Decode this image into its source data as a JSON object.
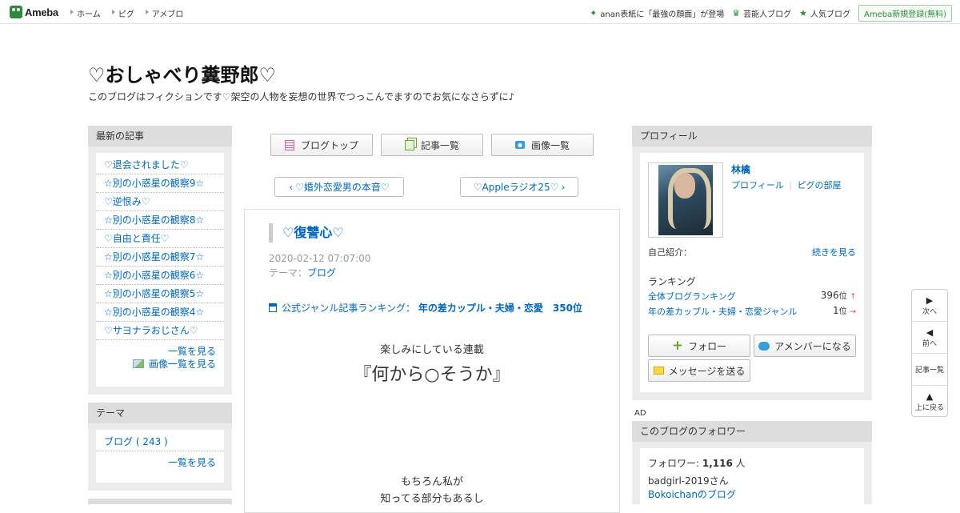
{
  "topbar": {
    "logo": "Ameba",
    "nav": [
      "ホーム",
      "ピグ",
      "アメブロ"
    ],
    "news": "anan表紙に「最強の顔面」が登場",
    "celeb": "芸能人ブログ",
    "popular": "人気ブログ",
    "register": "Ameba新規登録(無料)"
  },
  "blog": {
    "title": "♡おしゃべり糞野郎♡",
    "description": "このブログはフィクションです♡架空の人物を妄想の世界でつっこんでますのでお気になさらずに♪"
  },
  "recent": {
    "header": "最新の記事",
    "items": [
      "♡退会されました♡",
      "☆別の小惑星の観察9☆",
      "♡逆恨み♡",
      "☆別の小惑星の観察8☆",
      "♡自由と責任♡",
      "☆別の小惑星の観察7☆",
      "☆別の小惑星の観察6☆",
      "☆別の小惑星の観察5☆",
      "☆別の小惑星の観察4☆",
      "♡サヨナラおじさん♡"
    ],
    "more": "一覧を見る",
    "images": "画像一覧を見る"
  },
  "theme": {
    "header": "テーマ",
    "item": "ブログ ( 243 )",
    "more": "一覧を見る"
  },
  "tabs": {
    "top": "ブログトップ",
    "list": "記事一覧",
    "images": "画像一覧"
  },
  "pager": {
    "prev": "♡婚外恋愛男の本音♡",
    "next": "♡Appleラジオ25♡"
  },
  "article": {
    "title": "♡復讐心♡",
    "date": "2020-02-12 07:07:00",
    "theme_label": "テーマ：",
    "theme": "ブログ",
    "rank_label": "公式ジャンル記事ランキング：",
    "rank_value": "年の差カップル・夫婦・恋愛　350位",
    "line1": "楽しみにしている連載",
    "line2": "『何から○そうか』",
    "line3": "もちろん私が",
    "line4": "知ってる部分もあるし"
  },
  "profile": {
    "header": "プロフィール",
    "name": "林檎",
    "link_profile": "プロフィール",
    "link_room": "ピグの部屋",
    "intro_label": "自己紹介：",
    "intro_more": "続きを見る",
    "ranking_label": "ランキング",
    "rank1_label": "全体ブログランキング",
    "rank1_value": "396",
    "rank1_unit": "位",
    "rank1_arrow": "↑",
    "rank2_label": "年の差カップル・夫婦・恋愛ジャンル",
    "rank2_value": "1",
    "rank2_unit": "位",
    "rank2_arrow": "→",
    "follow": "フォロー",
    "member": "アメンバーになる",
    "message": "メッセージを送る"
  },
  "ad": "AD",
  "followers": {
    "header": "このブログのフォロワー",
    "label": "フォロワー:",
    "count": "1,116",
    "unit": "人",
    "user": "badgirl-2019さん",
    "blog_link": "Bokoichanのブログ"
  },
  "floatnav": {
    "next": "次へ",
    "prev": "前へ",
    "list": "記事一覧",
    "top": "上に戻る"
  },
  "colors": {
    "link": "#0066bb",
    "brand": "#2d8c3c",
    "rank_up": "#d33"
  }
}
